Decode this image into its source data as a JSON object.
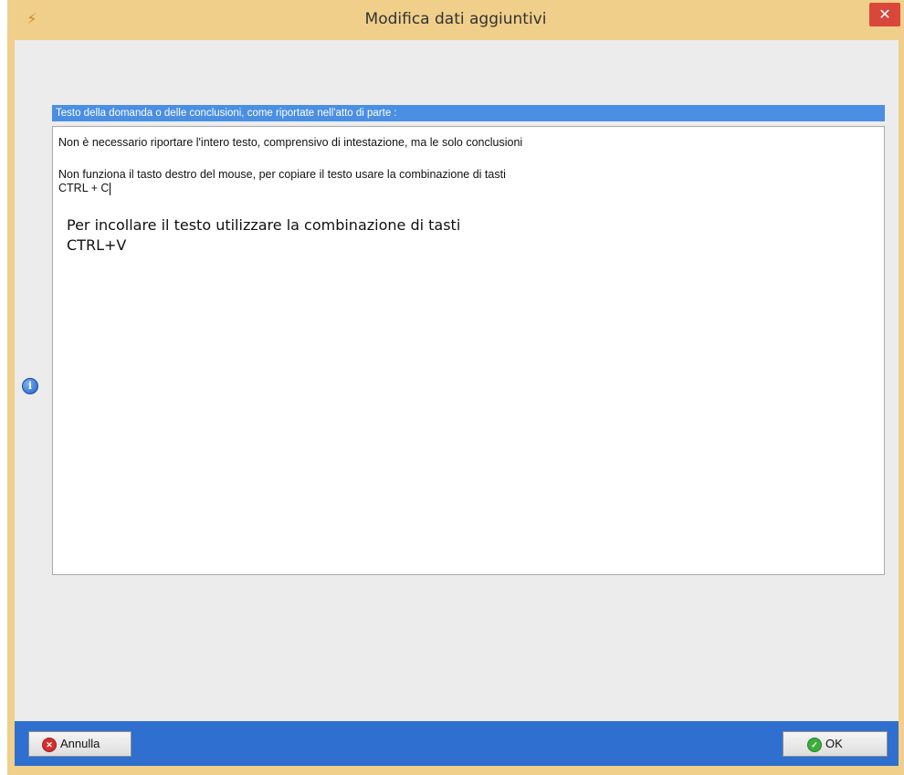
{
  "window": {
    "title": "Modifica dati aggiuntivi",
    "app_icon": "app-logo-icon",
    "close_symbol": "✕"
  },
  "field": {
    "header": "Testo della domanda o delle conclusioni, come riportate nell'atto di parte :",
    "lines": [
      "Non è necessario riportare l'intero testo, comprensivo di intestazione, ma le solo conclusioni",
      "Non funziona il tasto destro del mouse, per copiare il testo usare la combinazione di tasti",
      "CTRL + C",
      "Per incollare il testo utilizzare la combinazione di tasti",
      "CTRL+V"
    ]
  },
  "buttons": {
    "cancel_label": "Annulla",
    "ok_label": "OK"
  },
  "colors": {
    "title_bar": "#f0cf8a",
    "header_bar": "#4a8fe3",
    "button_bar": "#2f6fd0",
    "close_button": "#d9473a"
  }
}
